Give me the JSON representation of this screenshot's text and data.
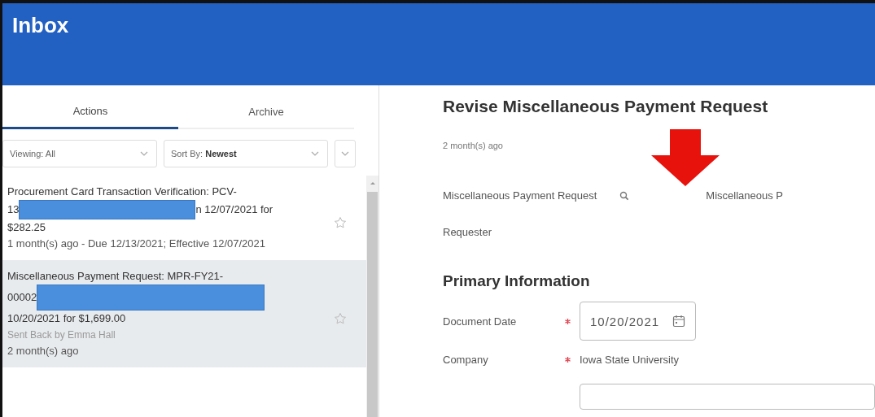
{
  "header": {
    "title": "Inbox"
  },
  "tabs": [
    {
      "label": "Actions",
      "selected": true
    },
    {
      "label": "Archive",
      "selected": false
    }
  ],
  "filters": [
    {
      "label": "Viewing:",
      "value": "All"
    },
    {
      "label": "Sort By:",
      "value": "Newest"
    }
  ],
  "items": [
    {
      "selected": false,
      "title_lines": [
        [
          {
            "kind": "text",
            "text": "Procurement Card Transaction Verification: PCV-"
          }
        ],
        [
          {
            "kind": "text",
            "text": "13"
          },
          {
            "kind": "redacted"
          },
          {
            "kind": "text",
            "text": "n 12/07/2021 for"
          }
        ],
        [
          {
            "kind": "text",
            "text": "$282.25"
          }
        ]
      ],
      "details": [
        {
          "kind": "meta",
          "text": "1 month(s) ago - Due 12/13/2021; Effective 12/07/2021"
        }
      ]
    },
    {
      "selected": true,
      "title_lines": [
        [
          {
            "kind": "text",
            "text": "Miscellaneous Payment Request: MPR-FY21-"
          }
        ],
        [
          {
            "kind": "text",
            "text": "00002"
          },
          {
            "kind": "redacted"
          }
        ],
        [
          {
            "kind": "text",
            "text": "10/20/2021 for $1,699.00"
          }
        ]
      ],
      "details": [
        {
          "kind": "status",
          "text": "Sent Back by Emma Hall"
        },
        {
          "kind": "meta",
          "text": "2 month(s) ago"
        }
      ]
    }
  ],
  "detail": {
    "title": "Revise Miscellaneous Payment Request",
    "age": "2 month(s) ago",
    "lookup": {
      "label": "Miscellaneous Payment Request",
      "value": "Miscellaneous P"
    },
    "requester": "Requester",
    "section": "Primary Information",
    "form": [
      {
        "kind": "date",
        "label": "Document Date",
        "required": true,
        "value": "10/20/2021"
      },
      {
        "kind": "text",
        "label": "Company",
        "required": true,
        "value": "Iowa State University"
      },
      {
        "kind": "input"
      }
    ]
  }
}
